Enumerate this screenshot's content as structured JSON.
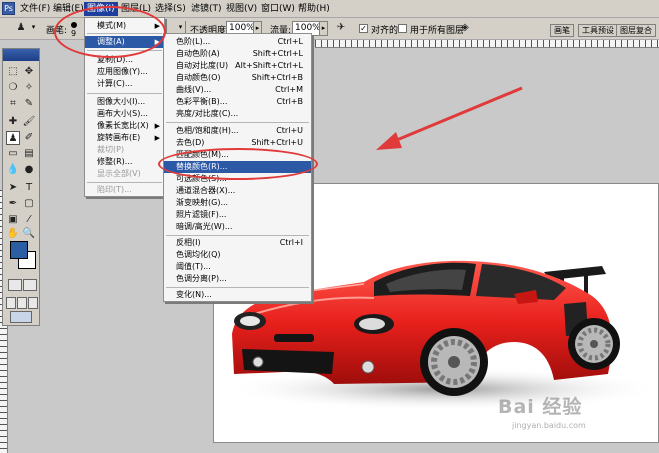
{
  "menubar": {
    "items": [
      "文件(F)",
      "编辑(E)",
      "图像(I)",
      "图层(L)",
      "选择(S)",
      "滤镜(T)",
      "视图(V)",
      "窗口(W)",
      "帮助(H)"
    ],
    "active": "图像(I)"
  },
  "options": {
    "brush_label": "画笔:",
    "brush_size": "9",
    "mode_value": "",
    "opacity_label": "不透明度:",
    "opacity_value": "100%",
    "flow_label": "流量:",
    "flow_value": "100%",
    "aligned_label": "对齐的",
    "aligned_checked": true,
    "all_layers_label": "用于所有图层",
    "all_layers_checked": false
  },
  "panel_tabs": [
    "画笔",
    "工具预设",
    "图层复合"
  ],
  "image_menu": {
    "items": [
      {
        "label": "模式(M)",
        "submenu": true
      },
      {
        "label": "调整(A)",
        "submenu": true,
        "highlighted": true
      },
      {
        "label": "复制(D)..."
      },
      {
        "label": "应用图像(Y)..."
      },
      {
        "label": "计算(C)..."
      },
      {
        "label": "图像大小(I)..."
      },
      {
        "label": "画布大小(S)..."
      },
      {
        "label": "像素长宽比(X)",
        "submenu": true
      },
      {
        "label": "旋转画布(E)",
        "submenu": true
      },
      {
        "label": "裁切(P)",
        "disabled": true
      },
      {
        "label": "修整(R)..."
      },
      {
        "label": "显示全部(V)",
        "disabled": true
      },
      {
        "label": "陷印(T)...",
        "disabled": true
      }
    ]
  },
  "adjust_menu": {
    "items": [
      {
        "label": "色阶(L)...",
        "shortcut": "Ctrl+L"
      },
      {
        "label": "自动色阶(A)",
        "shortcut": "Shift+Ctrl+L"
      },
      {
        "label": "自动对比度(U)",
        "shortcut": "Alt+Shift+Ctrl+L"
      },
      {
        "label": "自动颜色(O)",
        "shortcut": "Shift+Ctrl+B"
      },
      {
        "label": "曲线(V)...",
        "shortcut": "Ctrl+M"
      },
      {
        "label": "色彩平衡(B)...",
        "shortcut": "Ctrl+B"
      },
      {
        "label": "亮度/对比度(C)...",
        "shortcut": ""
      },
      {
        "label": "色相/饱和度(H)...",
        "shortcut": "Ctrl+U"
      },
      {
        "label": "去色(D)",
        "shortcut": "Shift+Ctrl+U"
      },
      {
        "label": "匹配颜色(M)...",
        "shortcut": ""
      },
      {
        "label": "替换颜色(R)...",
        "shortcut": "",
        "highlighted": true
      },
      {
        "label": "可选颜色(S)...",
        "shortcut": ""
      },
      {
        "label": "通道混合器(X)...",
        "shortcut": ""
      },
      {
        "label": "渐变映射(G)...",
        "shortcut": ""
      },
      {
        "label": "照片滤镜(F)...",
        "shortcut": ""
      },
      {
        "label": "暗调/高光(W)...",
        "shortcut": ""
      },
      {
        "label": "反相(I)",
        "shortcut": "Ctrl+I"
      },
      {
        "label": "色调均化(Q)",
        "shortcut": ""
      },
      {
        "label": "阈值(T)...",
        "shortcut": ""
      },
      {
        "label": "色调分离(P)...",
        "shortcut": ""
      },
      {
        "label": "变化(N)...",
        "shortcut": ""
      }
    ]
  },
  "watermark": {
    "text": "Bai 经验",
    "sub": "jingyan.baidu.com"
  },
  "colors": {
    "menu_highlight": "#2c59a6",
    "menubar_active": "#1f3f9f",
    "annotation_red": "#e03a3a",
    "car_red": "#e8201c",
    "foreground_swatch": "#2b5ea3"
  }
}
